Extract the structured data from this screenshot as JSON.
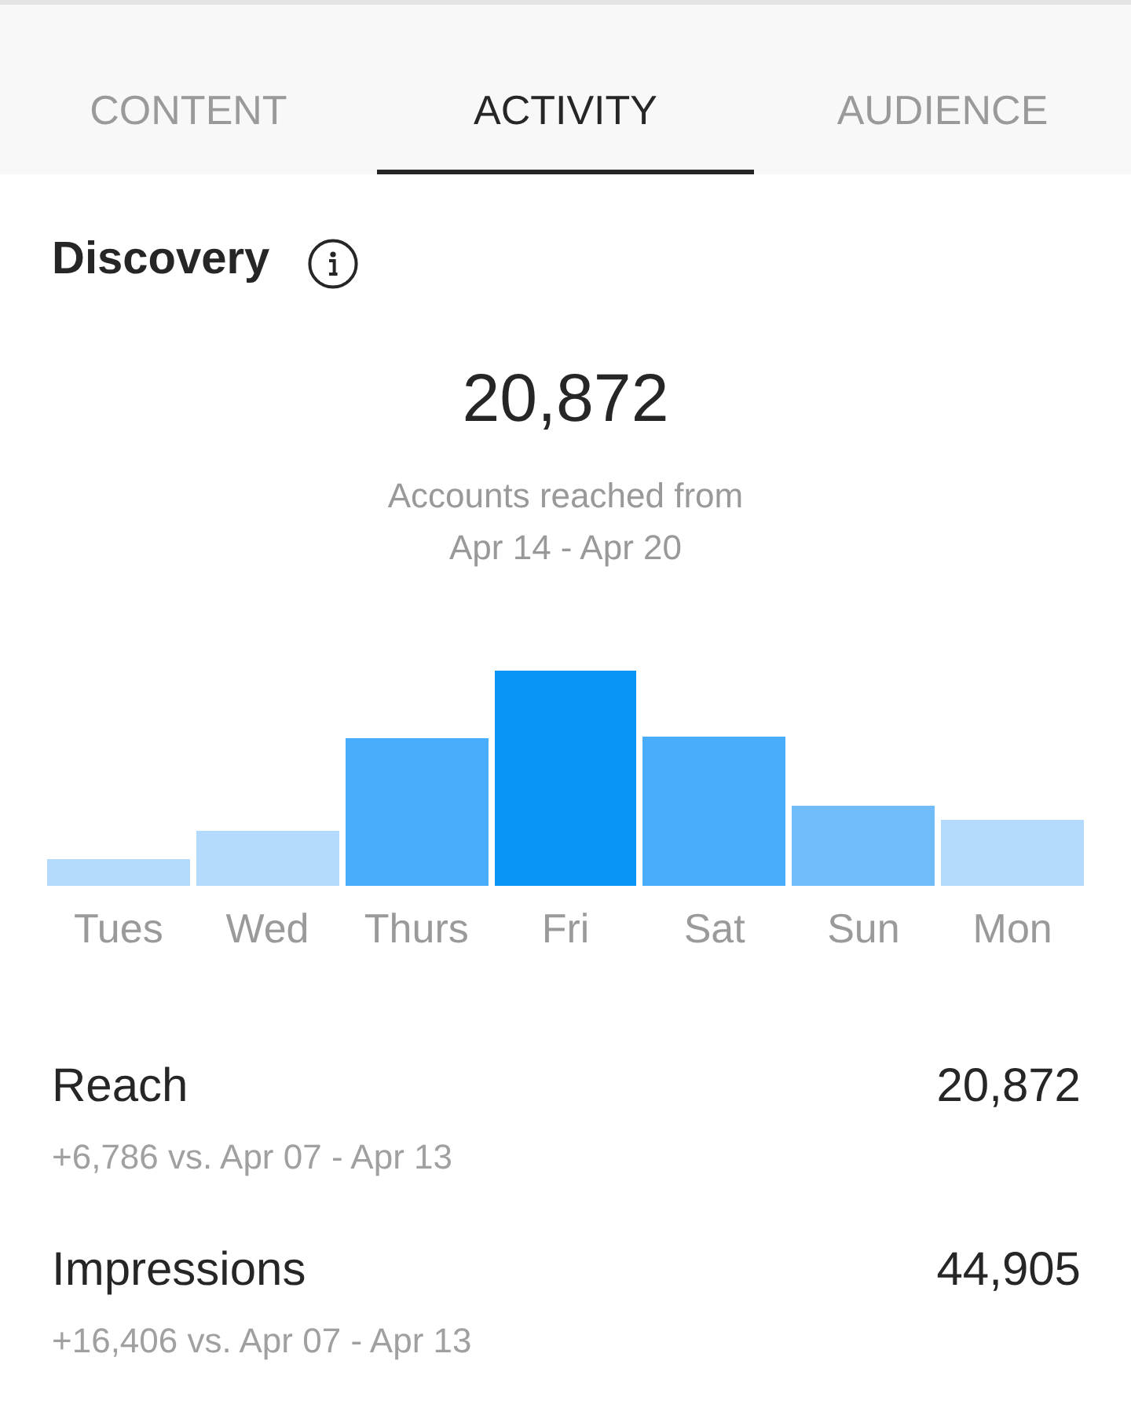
{
  "tabs": [
    {
      "label": "CONTENT",
      "selected": false
    },
    {
      "label": "ACTIVITY",
      "selected": true
    },
    {
      "label": "AUDIENCE",
      "selected": false
    }
  ],
  "discovery": {
    "title": "Discovery",
    "total": "20,872",
    "caption": "Accounts reached from",
    "date_range": "Apr 14 - Apr 20",
    "days": [
      "Tues",
      "Wed",
      "Thurs",
      "Fri",
      "Sat",
      "Sun",
      "Mon"
    ]
  },
  "metrics": [
    {
      "label": "Reach",
      "value": "20,872",
      "change": "+6,786 vs. Apr 07 - Apr 13"
    },
    {
      "label": "Impressions",
      "value": "44,905",
      "change": "+16,406 vs. Apr 07 - Apr 13"
    }
  ]
}
